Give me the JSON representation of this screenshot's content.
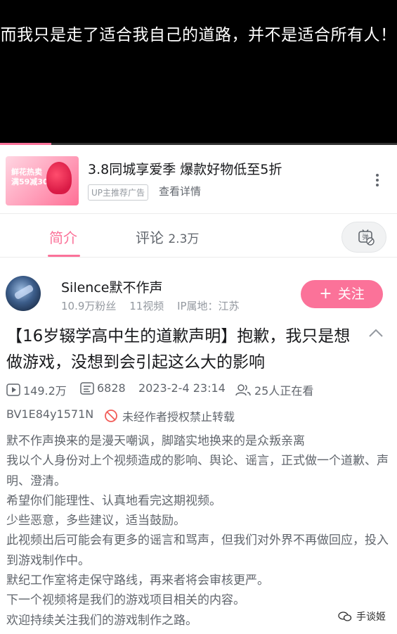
{
  "player": {
    "subtitle": "而我只是走了适合我自己的道路，并不是适合所有人！",
    "progress_percent": 13,
    "accent_color": "#fb7299"
  },
  "ad": {
    "title": "3.8同城享爱季 爆款好物低至5折",
    "tag": "UP主推荐广告",
    "link_label": "查看详情",
    "thumb_text": [
      "鲜花热卖",
      "满59减30"
    ],
    "more_icon": "more-vertical-icon"
  },
  "tabs": {
    "intro_label": "简介",
    "comments_label": "评论",
    "comments_count": "2.3万",
    "danmaku_icon": "danmaku-off-icon",
    "danmaku_glyph": "弹"
  },
  "author": {
    "name": "Silence默不作声",
    "fans": "10.9万粉丝",
    "videos": "11视频",
    "ip": "IP属地：江苏",
    "follow_label": "关注"
  },
  "video": {
    "title": "【16岁辍学高中生的道歉声明】抱歉，我只是想做游戏，没想到会引起这么大的影响",
    "views": "149.2万",
    "danmaku_count": "6828",
    "date": "2023-2-4 23:14",
    "watching": "25人正在看",
    "bvid": "BV1E84y1571N",
    "no_repost": "未经作者授权禁止转载",
    "description": [
      "默不作声换来的是漫天嘲讽，脚踏实地换来的是众叛亲离",
      "我以个人身份对上个视频造成的影响、舆论、谣言，正式做一个道歉、声明、澄清。",
      "希望你们能理性、认真地看完这期视频。",
      "少些恶意，多些建议，适当鼓励。",
      "此视频出后可能会有更多的谣言和骂声，但我们对外界不再做回应，投入到游戏制作中。",
      "默纪工作室将走保守路线，再来者将会审核更严。",
      "下一个视频将是我们的游戏项目相关的内容。",
      "欢迎持续关注我们的游戏制作之路。"
    ]
  },
  "watermark": {
    "label": "手谈姬"
  }
}
